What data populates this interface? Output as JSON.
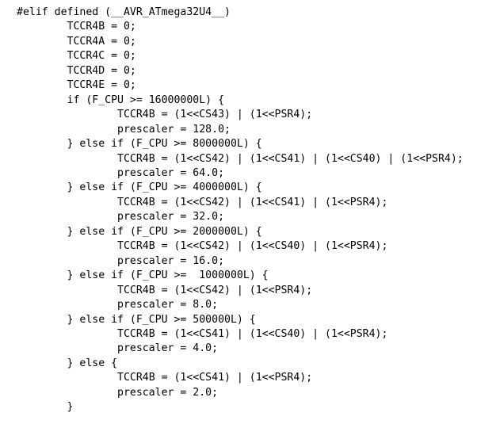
{
  "document": {
    "kind": "source-code-listing",
    "language": "c",
    "background_color": "#ffffff",
    "text_color": "#000000",
    "line_count": 28,
    "lines": [
      "#elif defined (__AVR_ATmega32U4__)",
      "        TCCR4B = 0;",
      "        TCCR4A = 0;",
      "        TCCR4C = 0;",
      "        TCCR4D = 0;",
      "        TCCR4E = 0;",
      "        if (F_CPU >= 16000000L) {",
      "                TCCR4B = (1<<CS43) | (1<<PSR4);",
      "                prescaler = 128.0;",
      "        } else if (F_CPU >= 8000000L) {",
      "                TCCR4B = (1<<CS42) | (1<<CS41) | (1<<CS40) | (1<<PSR4);",
      "                prescaler = 64.0;",
      "        } else if (F_CPU >= 4000000L) {",
      "                TCCR4B = (1<<CS42) | (1<<CS41) | (1<<PSR4);",
      "                prescaler = 32.0;",
      "        } else if (F_CPU >= 2000000L) {",
      "                TCCR4B = (1<<CS42) | (1<<CS40) | (1<<PSR4);",
      "                prescaler = 16.0;",
      "        } else if (F_CPU >=  1000000L) {",
      "                TCCR4B = (1<<CS42) | (1<<PSR4);",
      "                prescaler = 8.0;",
      "        } else if (F_CPU >= 500000L) {",
      "                TCCR4B = (1<<CS41) | (1<<CS40) | (1<<PSR4);",
      "                prescaler = 4.0;",
      "        } else {",
      "                TCCR4B = (1<<CS41) | (1<<PSR4);",
      "                prescaler = 2.0;",
      "        }"
    ]
  }
}
